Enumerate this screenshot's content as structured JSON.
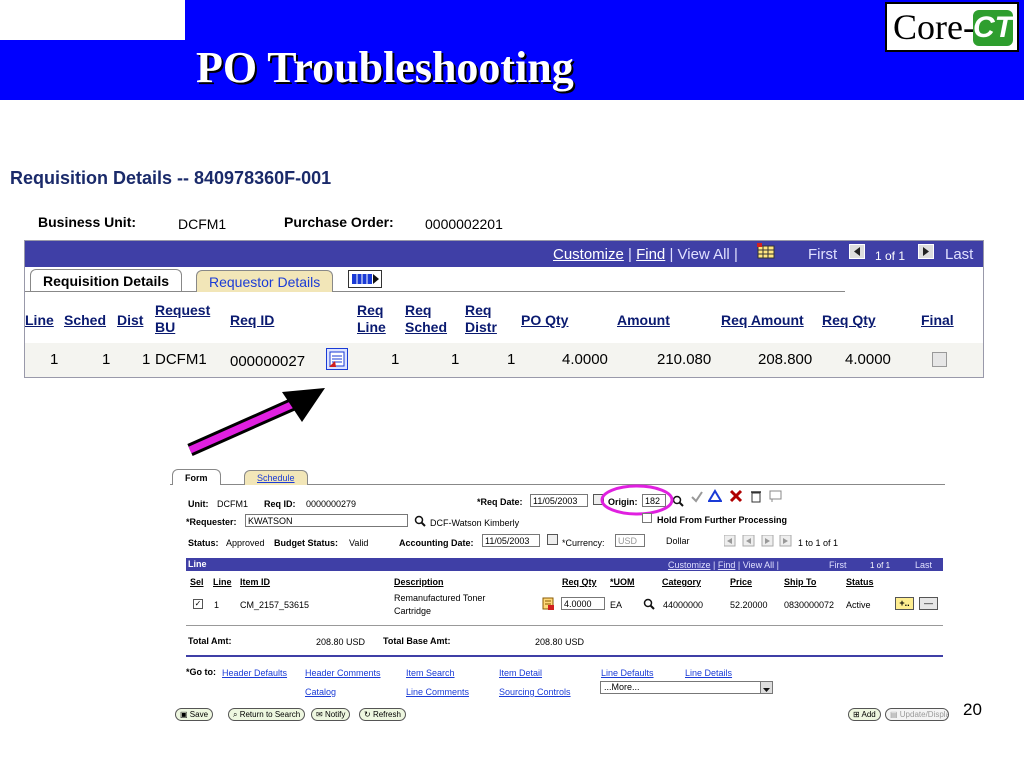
{
  "slide": {
    "title": "PO Troubleshooting",
    "logo_core": "Core-",
    "logo_ct": "CT",
    "page_number": "20"
  },
  "top": {
    "title": "Requisition Details -- 840978360F-001",
    "business_unit_label": "Business Unit:",
    "business_unit": "DCFM1",
    "po_label": "Purchase Order:",
    "po_value": "0000002201",
    "nav": {
      "customize": "Customize",
      "find": "Find",
      "view_all": "View All",
      "first": "First",
      "count": "1 of 1",
      "last": "Last"
    },
    "tabs": [
      "Requisition Details",
      "Requestor Details"
    ],
    "headers": {
      "line": "Line",
      "sched": "Sched",
      "dist": "Dist",
      "req_bu_1": "Request",
      "req_bu_2": "BU",
      "req_id": "Req ID",
      "req_line_1": "Req",
      "req_line_2": "Line",
      "req_sched_1": "Req",
      "req_sched_2": "Sched",
      "req_distr_1": "Req",
      "req_distr_2": "Distr",
      "po_qty": "PO Qty",
      "amount": "Amount",
      "req_amount": "Req Amount",
      "req_qty": "Req Qty",
      "final": "Final"
    },
    "row": {
      "line": "1",
      "sched": "1",
      "dist": "1",
      "bu": "DCFM1",
      "req_id": "000000027",
      "req_line": "1",
      "req_sched": "1",
      "req_distr": "1",
      "po_qty": "4.0000",
      "amount": "210.080",
      "req_amount": "208.800",
      "req_qty": "4.0000"
    }
  },
  "form": {
    "tabs": [
      "Form",
      "Schedule"
    ],
    "unit_label": "Unit:",
    "unit": "DCFM1",
    "reqid_label": "Req ID:",
    "reqid": "0000000279",
    "reqdate_label": "*Req Date:",
    "reqdate": "11/05/2003",
    "origin_label": "Origin:",
    "origin": "182",
    "requester_label": "*Requester:",
    "requester": "KWATSON",
    "requester_name": "DCF-Watson Kimberly",
    "hold_label": "Hold From Further Processing",
    "status_label": "Status:",
    "status": "Approved",
    "budget_label": "Budget Status:",
    "budget": "Valid",
    "acct_label": "Accounting Date:",
    "acct": "11/05/2003",
    "currency_label": "*Currency:",
    "currency_code": "USD",
    "currency_name": "Dollar",
    "pager": "1 to 1 of 1",
    "line_section": "Line",
    "line_nav": {
      "customize": "Customize",
      "find": "Find",
      "view_all": "View All",
      "first": "First",
      "count": "1 of 1",
      "last": "Last"
    },
    "line_headers": {
      "sel": "Sel",
      "line": "Line",
      "item": "Item ID",
      "desc": "Description",
      "qty": "Req Qty",
      "uom": "*UOM",
      "cat": "Category",
      "price": "Price",
      "ship": "Ship To",
      "status": "Status"
    },
    "line_row": {
      "line": "1",
      "item": "CM_2157_53615",
      "desc1": "Remanufactured Toner",
      "desc2": "Cartridge",
      "qty": "4.0000",
      "uom": "EA",
      "cat": "44000000",
      "price": "52.20000",
      "ship": "0830000072",
      "status": "Active",
      "add": "+..",
      "del": "—"
    },
    "total_label": "Total Amt:",
    "total": "208.80  USD",
    "base_label": "Total Base Amt:",
    "base": "208.80  USD",
    "goto_label": "*Go to:",
    "goto_links": [
      "Header Defaults",
      "Header Comments",
      "Item Search",
      "Item Detail",
      "Line Defaults",
      "Line Details",
      "Catalog",
      "Line Comments",
      "Sourcing Controls"
    ],
    "more": "...More...",
    "buttons": {
      "save": "Save",
      "return": "Return to Search",
      "notify": "Notify",
      "refresh": "Refresh",
      "add": "Add",
      "update": "Update/Displa"
    }
  },
  "colors": {
    "slide_blue": "#0000ff",
    "grid_header": "#3f3fa6",
    "highlight": "#e020e0",
    "arrow": "#000000"
  }
}
